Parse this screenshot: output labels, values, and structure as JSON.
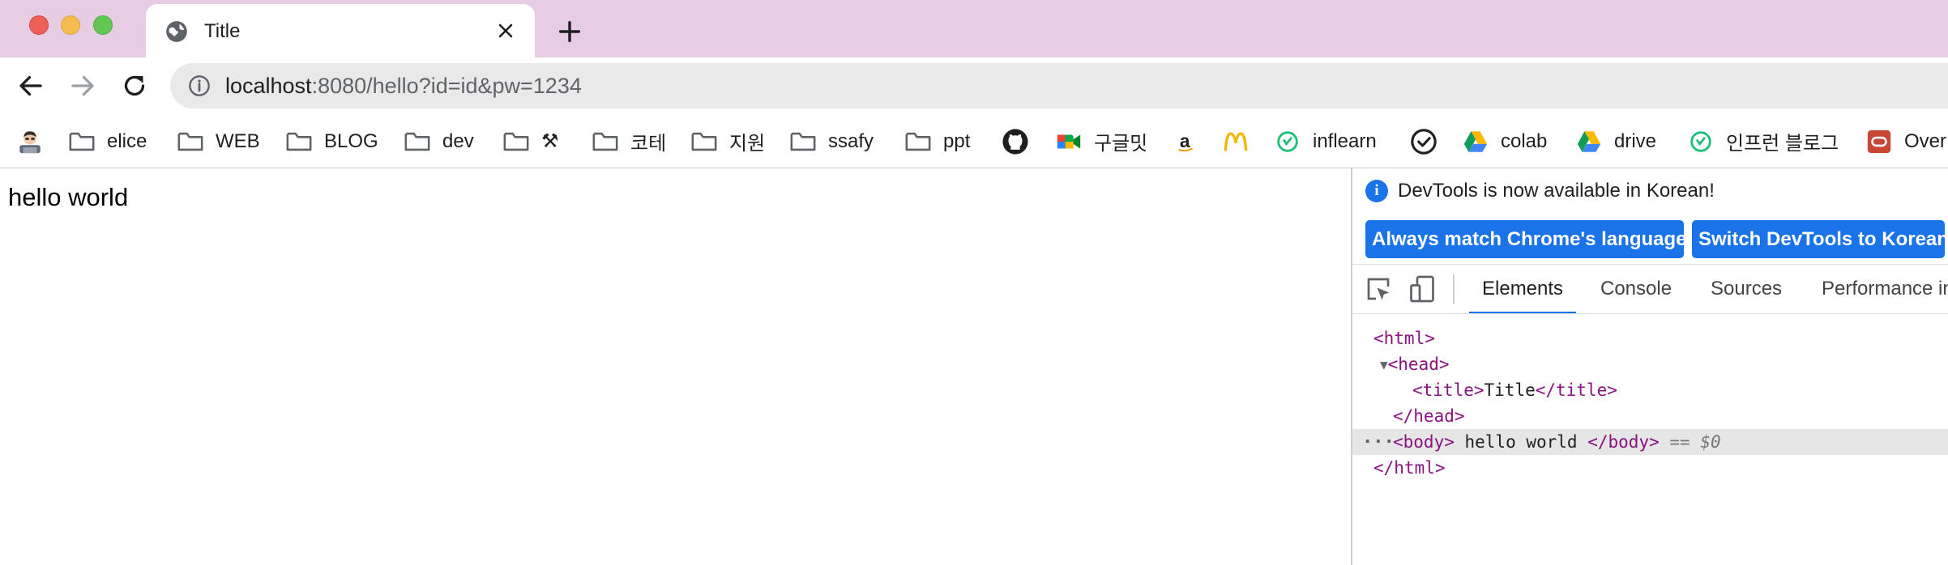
{
  "tab": {
    "title": "Title"
  },
  "omnibox": {
    "url_host": "localhost",
    "url_rest": ":8080/hello?id=id&pw=1234"
  },
  "bookmarks": [
    {
      "label": "",
      "icon": "avatar-icon"
    },
    {
      "label": "elice",
      "icon": "folder-icon"
    },
    {
      "label": "WEB",
      "icon": "folder-icon"
    },
    {
      "label": "BLOG",
      "icon": "folder-icon"
    },
    {
      "label": "dev",
      "icon": "folder-icon"
    },
    {
      "label": "⚒",
      "icon": "folder-icon"
    },
    {
      "label": "코테",
      "icon": "folder-icon"
    },
    {
      "label": "지원",
      "icon": "folder-icon"
    },
    {
      "label": "ssafy",
      "icon": "folder-icon"
    },
    {
      "label": "ppt",
      "icon": "folder-icon"
    },
    {
      "label": "",
      "icon": "github-icon"
    },
    {
      "label": "구글밋",
      "icon": "google-meet-icon"
    },
    {
      "label": "",
      "icon": "amazon-icon"
    },
    {
      "label": "",
      "icon": "mcdonalds-icon"
    },
    {
      "label": "inflearn",
      "icon": "inflearn-icon"
    },
    {
      "label": "",
      "icon": "checkmark-circle-icon"
    },
    {
      "label": "colab",
      "icon": "google-drive-icon"
    },
    {
      "label": "drive",
      "icon": "google-drive-icon"
    },
    {
      "label": "인프런 블로그",
      "icon": "inflearn-icon"
    },
    {
      "label": "Over",
      "icon": "oracle-icon"
    }
  ],
  "page": {
    "body_text": "hello world"
  },
  "devtools": {
    "notice": "DevTools is now available in Korean!",
    "button_match": "Always match Chrome's language",
    "button_switch": "Switch DevTools to Korean",
    "tabs": [
      "Elements",
      "Console",
      "Sources",
      "Performance in"
    ],
    "active_tab": "Elements",
    "dom": {
      "html_open": "<html>",
      "head_open": "<head>",
      "title_open": "<title>",
      "title_text": "Title",
      "title_close": "</title>",
      "head_close": "</head>",
      "body_open": "<body>",
      "body_text": " hello world ",
      "body_close": "</body>",
      "selected_marker": "== $0",
      "html_close": "</html>"
    }
  },
  "colors": {
    "tabstrip": "#e7cde4",
    "accent": "#1a73e8",
    "tag": "#881280"
  }
}
